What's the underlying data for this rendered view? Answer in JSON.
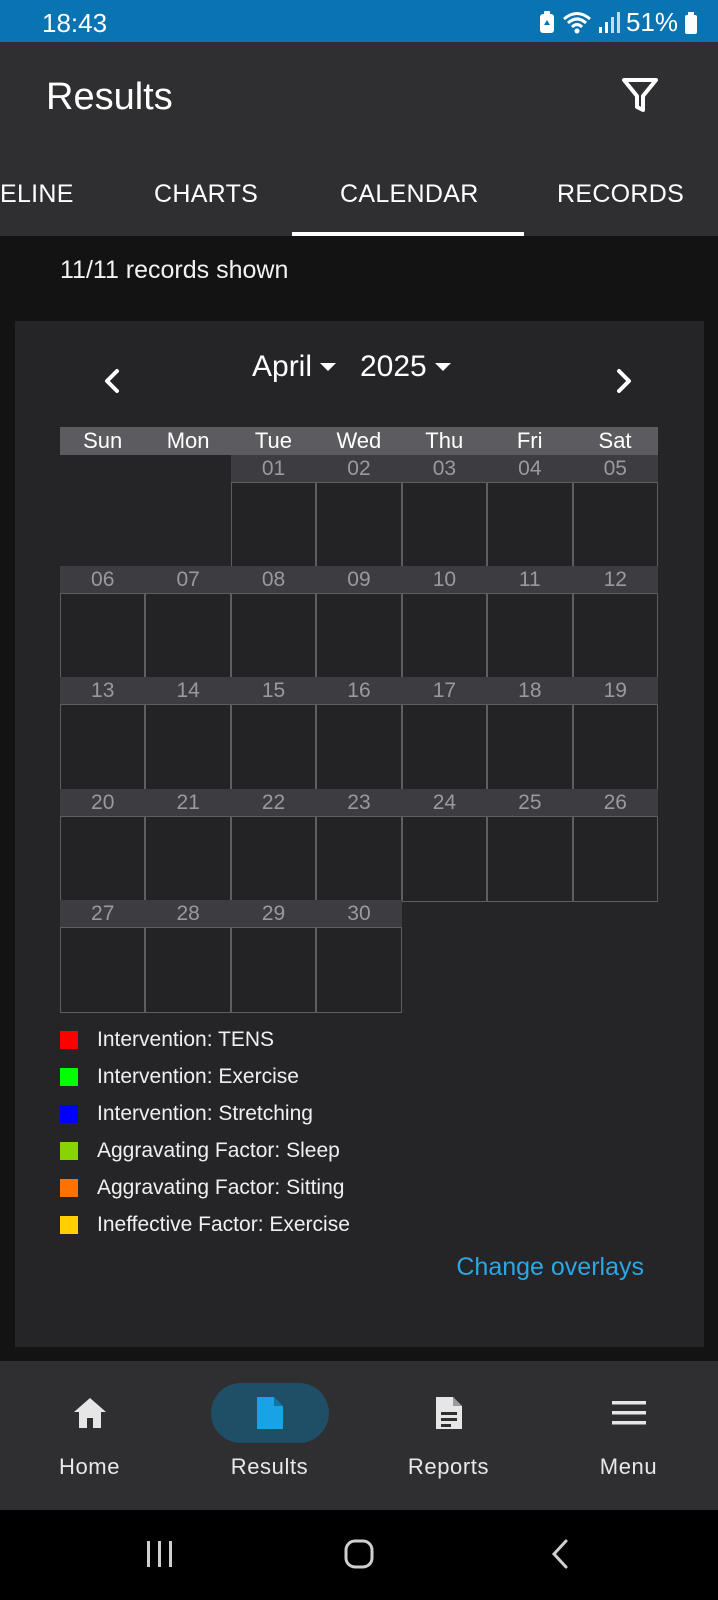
{
  "status_bar": {
    "time": "18:43",
    "battery": "51%"
  },
  "app_bar": {
    "title": "Results",
    "filter_icon": "filter-icon"
  },
  "tabs": [
    {
      "label": "ELINE"
    },
    {
      "label": "CHARTS"
    },
    {
      "label": "CALENDAR",
      "selected": true
    },
    {
      "label": "RECORDS"
    }
  ],
  "records_shown": "11/11 records shown",
  "calendar": {
    "month": "April",
    "year": "2025",
    "weekdays": [
      "Sun",
      "Mon",
      "Tue",
      "Wed",
      "Thu",
      "Fri",
      "Sat"
    ],
    "first_day_column": 2,
    "days": [
      "01",
      "02",
      "03",
      "04",
      "05",
      "06",
      "07",
      "08",
      "09",
      "10",
      "11",
      "12",
      "13",
      "14",
      "15",
      "16",
      "17",
      "18",
      "19",
      "20",
      "21",
      "22",
      "23",
      "24",
      "25",
      "26",
      "27",
      "28",
      "29",
      "30"
    ]
  },
  "legend": [
    {
      "label": "Intervention: TENS",
      "color": "#ff0000"
    },
    {
      "label": "Intervention: Exercise",
      "color": "#00ff00"
    },
    {
      "label": "Intervention: Stretching",
      "color": "#0000ff"
    },
    {
      "label": "Aggravating Factor: Sleep",
      "color": "#88d400"
    },
    {
      "label": "Aggravating Factor: Sitting",
      "color": "#ff7200"
    },
    {
      "label": "Ineffective Factor: Exercise",
      "color": "#ffd000"
    }
  ],
  "change_overlays": "Change overlays",
  "bottom_nav": [
    {
      "label": "Home",
      "icon": "home-icon"
    },
    {
      "label": "Results",
      "icon": "document-icon",
      "selected": true
    },
    {
      "label": "Reports",
      "icon": "report-icon"
    },
    {
      "label": "Menu",
      "icon": "menu-icon"
    }
  ],
  "colors": {
    "accent": "#2aa7e7",
    "status_bar": "#0a73b1",
    "app_bar": "#2f2f31",
    "active_nav": "#1f4f66"
  }
}
